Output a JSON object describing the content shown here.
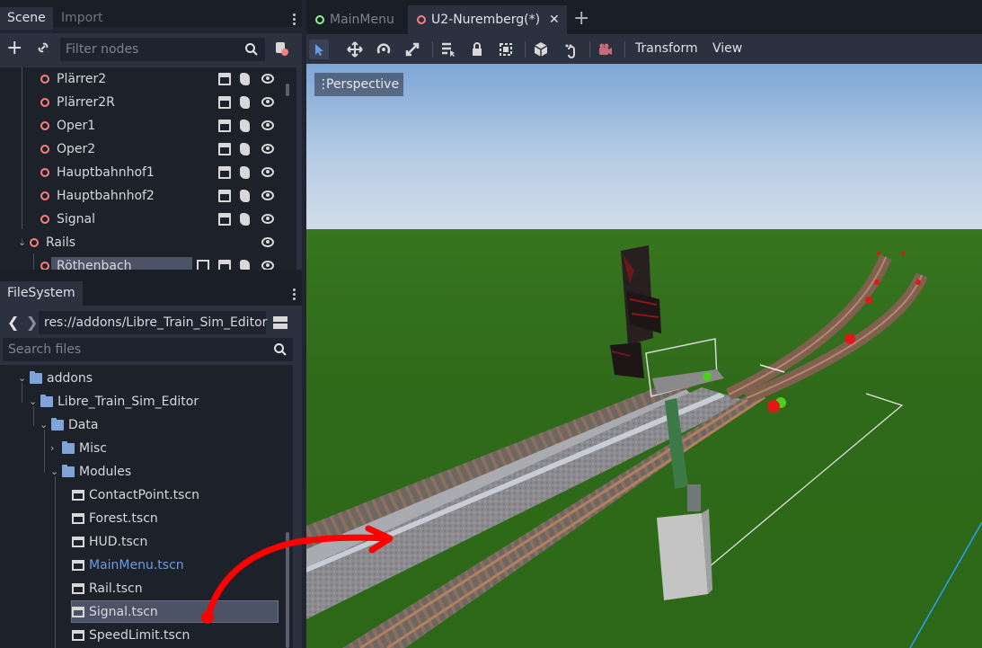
{
  "scene_dock": {
    "tabs": [
      "Scene",
      "Import"
    ],
    "filter_placeholder": "Filter nodes",
    "nodes": [
      {
        "label": "Plärrer2",
        "icons": [
          "clap",
          "script",
          "eye"
        ]
      },
      {
        "label": "Plärrer2R",
        "icons": [
          "clap",
          "script",
          "eye"
        ]
      },
      {
        "label": "Oper1",
        "icons": [
          "clap",
          "script",
          "eye"
        ]
      },
      {
        "label": "Oper2",
        "icons": [
          "clap",
          "script",
          "eye"
        ]
      },
      {
        "label": "Hauptbahnhof1",
        "icons": [
          "clap",
          "script",
          "eye"
        ]
      },
      {
        "label": "Hauptbahnhof2",
        "icons": [
          "clap",
          "script",
          "eye"
        ]
      },
      {
        "label": "Signal",
        "icons": [
          "clap",
          "script",
          "eye"
        ]
      },
      {
        "label": "Rails",
        "icons": [
          "eye"
        ]
      },
      {
        "label": "Röthenbach",
        "icons": [
          "group",
          "clap",
          "script",
          "eye"
        ]
      }
    ]
  },
  "filesystem_dock": {
    "tab": "FileSystem",
    "path": "res://addons/Libre_Train_Sim_Editor",
    "search_placeholder": "Search files",
    "tree": [
      {
        "label": "addons",
        "kind": "folder"
      },
      {
        "label": "Libre_Train_Sim_Editor",
        "kind": "folder"
      },
      {
        "label": "Data",
        "kind": "folder"
      },
      {
        "label": "Misc",
        "kind": "folder"
      },
      {
        "label": "Modules",
        "kind": "folder"
      },
      {
        "label": "ContactPoint.tscn",
        "kind": "scene"
      },
      {
        "label": "Forest.tscn",
        "kind": "scene"
      },
      {
        "label": "HUD.tscn",
        "kind": "scene"
      },
      {
        "label": "MainMenu.tscn",
        "kind": "scene"
      },
      {
        "label": "Rail.tscn",
        "kind": "scene"
      },
      {
        "label": "Signal.tscn",
        "kind": "scene"
      },
      {
        "label": "SpeedLimit.tscn",
        "kind": "scene"
      }
    ]
  },
  "editor_tabs": [
    {
      "label": "MainMenu",
      "active": false,
      "dot_color": "#8eef97"
    },
    {
      "label": "U2-Nuremberg(*)",
      "active": true,
      "dot_color": "#fc7f7f"
    }
  ],
  "viewport_toolbar": {
    "menus": [
      "Transform",
      "View"
    ],
    "tools": [
      "select-icon",
      "move-icon",
      "rotate-icon",
      "scale-icon",
      "list-select-icon",
      "lock-icon",
      "group-icon",
      "local-space-icon",
      "snap-icon",
      "camera-icon"
    ]
  },
  "viewport": {
    "mode_label": "Perspective"
  },
  "colors": {
    "accent": "#699ce8",
    "node_red": "#fc7f7f",
    "selected_bg": "#4d5366",
    "annotation_red": "#ff0000"
  }
}
